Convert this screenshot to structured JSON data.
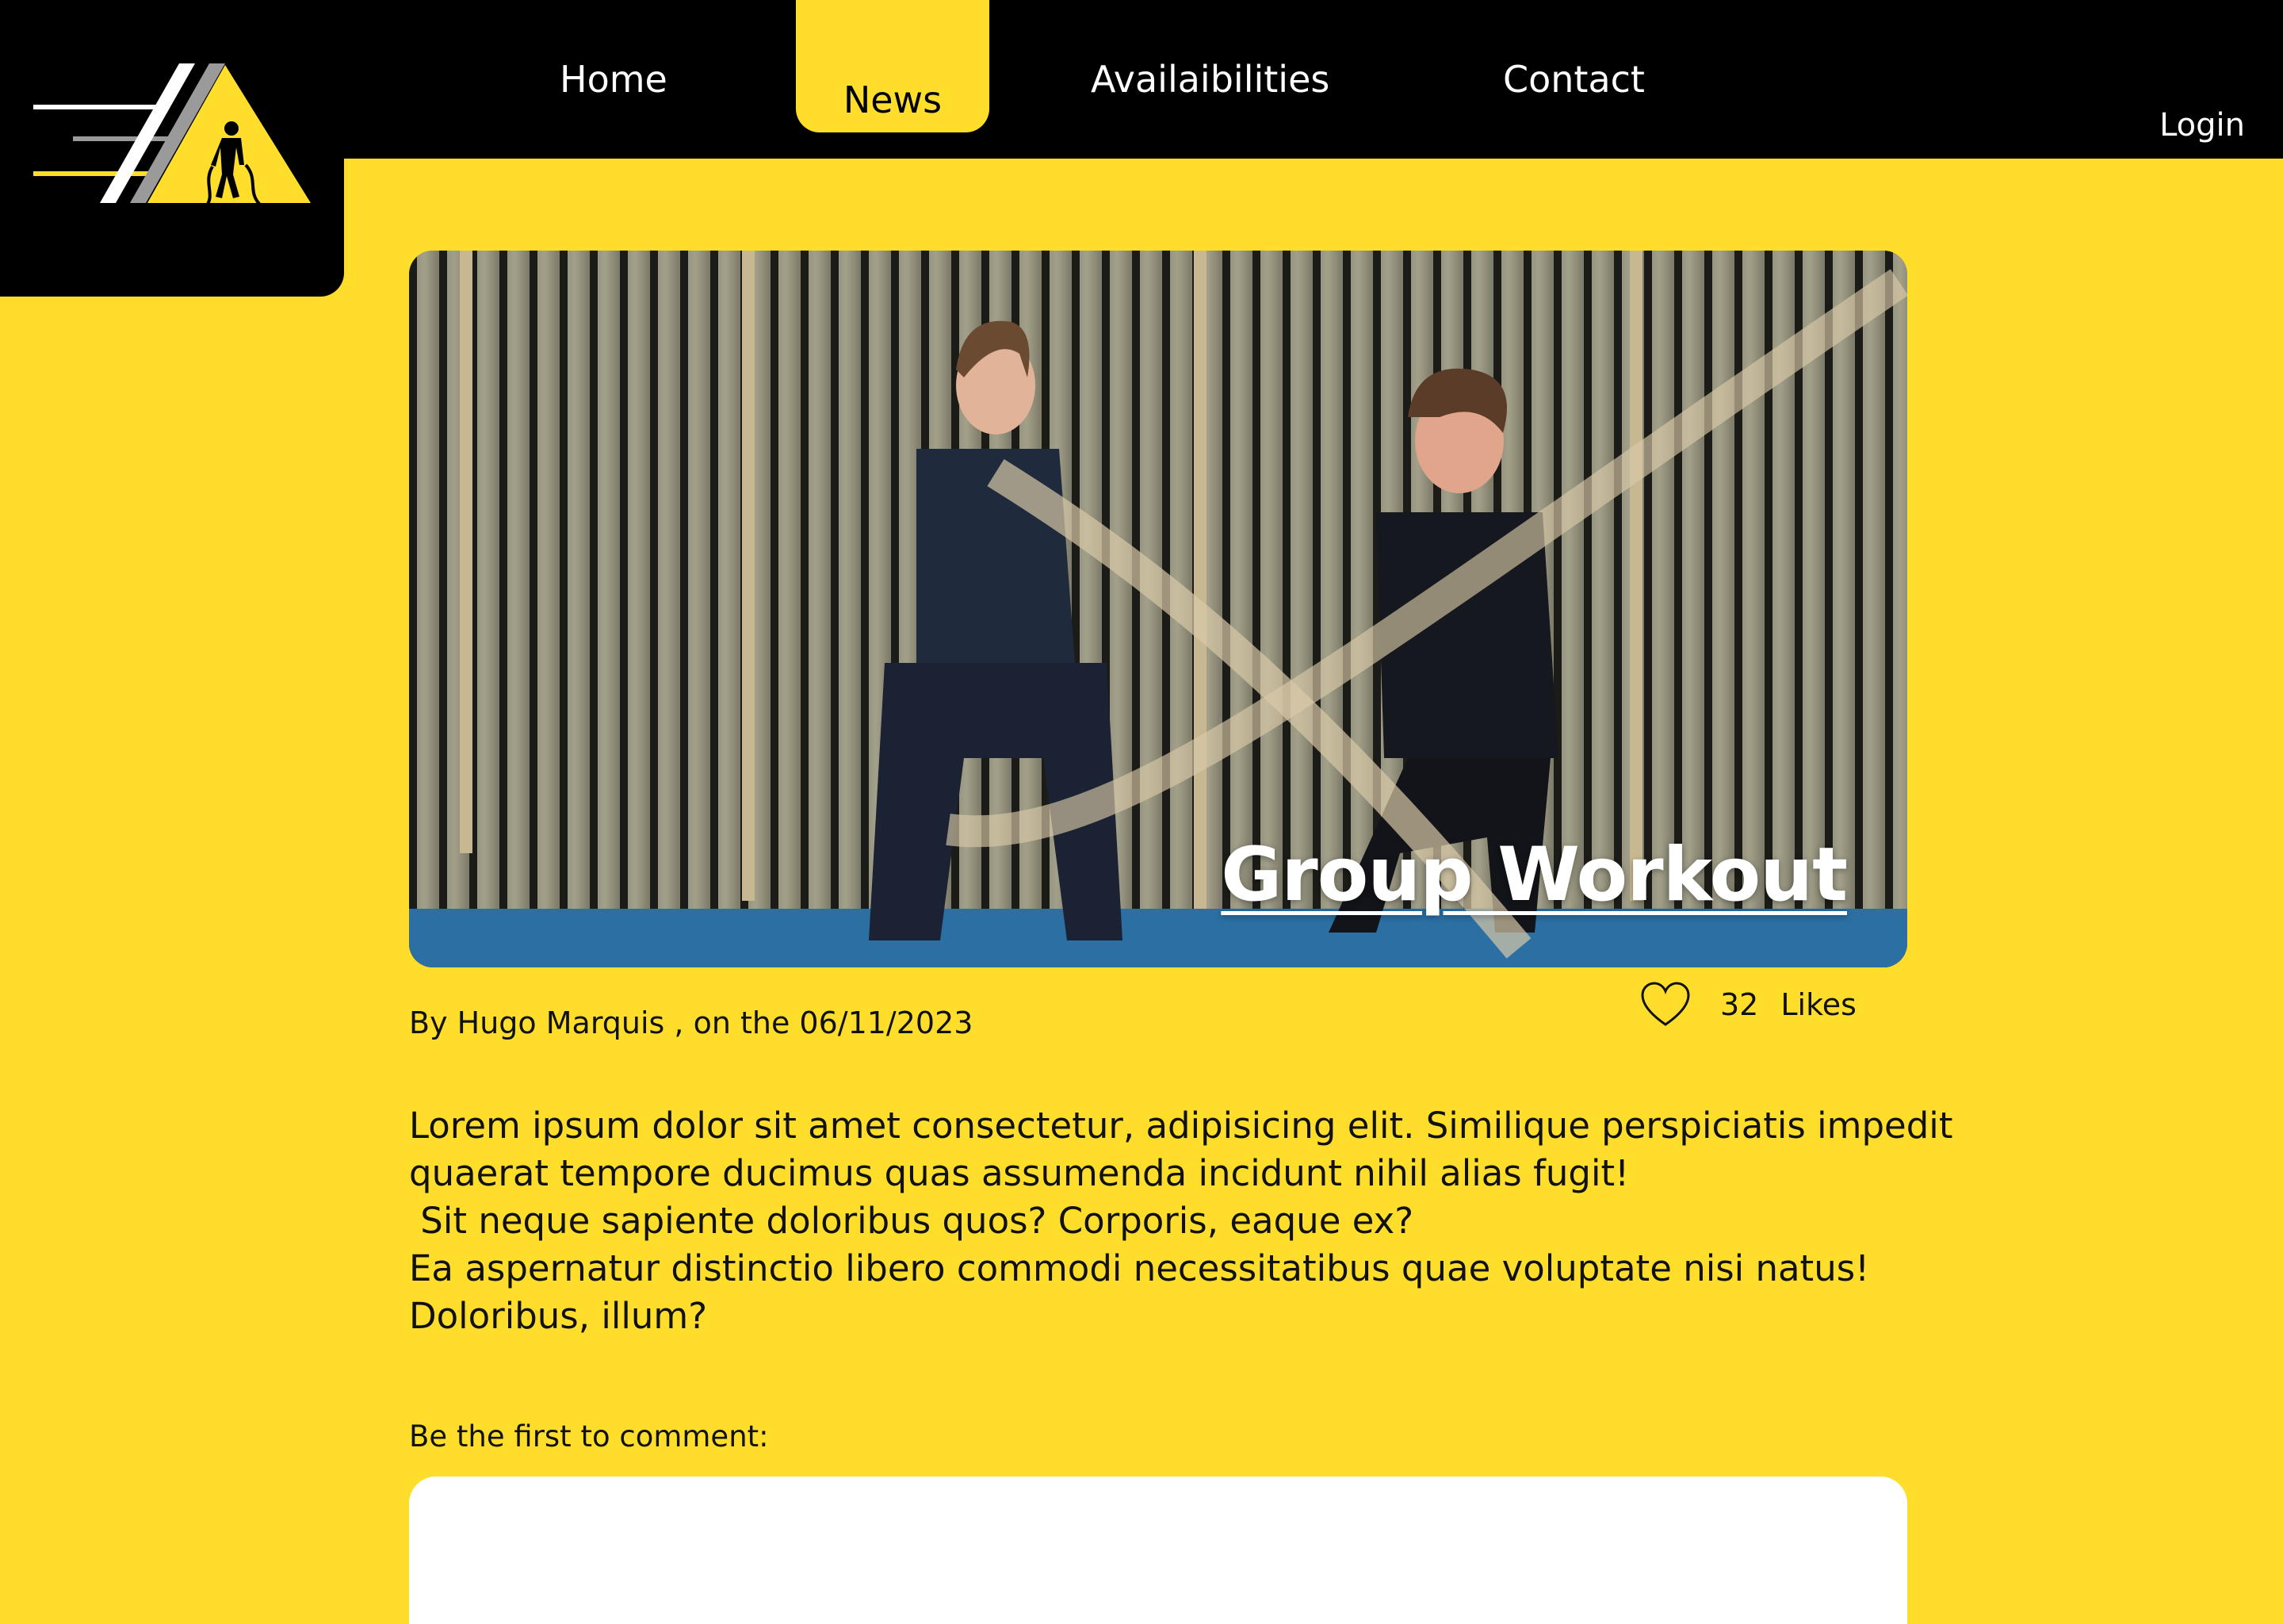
{
  "nav": {
    "items": [
      {
        "label": "Home"
      },
      {
        "label": "News"
      },
      {
        "label": "Availaibilities"
      },
      {
        "label": "Contact"
      }
    ],
    "active": "News",
    "login_label": "Login"
  },
  "colors": {
    "accent_yellow": "#FFDE2B",
    "header_black": "#000000",
    "white": "#FFFFFF"
  },
  "logo": {
    "icon": "triangle-athlete-logo"
  },
  "article": {
    "image_title": "Group Workout",
    "byline": "By Hugo Marquis , on the 06/11/2023",
    "likes": {
      "count": "32",
      "label": "Likes",
      "icon": "heart-icon"
    },
    "paragraphs": [
      "Lorem ipsum dolor sit amet consectetur, adipisicing elit. Similique perspiciatis impedit",
      "quaerat tempore ducimus quas assumenda incidunt nihil alias fugit!",
      " Sit neque sapiente doloribus quos? Corporis, eaque ex?",
      "Ea aspernatur distinctio libero commodi necessitatibus quae voluptate nisi natus!",
      "Doloribus, illum?"
    ]
  },
  "comments": {
    "prompt": "Be the first to comment:",
    "input_value": ""
  }
}
